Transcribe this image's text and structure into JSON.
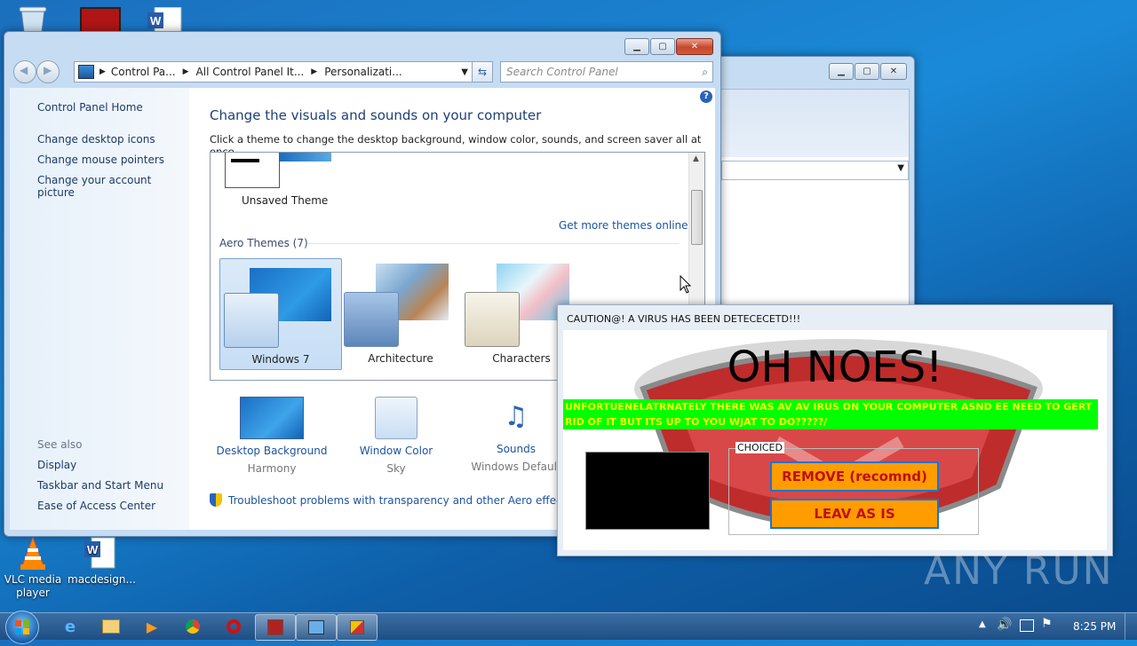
{
  "desktop": {
    "icons": [
      {
        "label": "VLC media player"
      },
      {
        "label": "macdesign..."
      }
    ],
    "watermark": "ANY RUN"
  },
  "control_panel": {
    "breadcrumb": [
      "Control Pa...",
      "All Control Panel It...",
      "Personalizati..."
    ],
    "search_placeholder": "Search Control Panel",
    "sidebar": {
      "home": "Control Panel Home",
      "links": [
        "Change desktop icons",
        "Change mouse pointers",
        "Change your account picture"
      ],
      "see_also_title": "See also",
      "see_also": [
        "Display",
        "Taskbar and Start Menu",
        "Ease of Access Center"
      ]
    },
    "main": {
      "title": "Change the visuals and sounds on your computer",
      "subtitle": "Click a theme to change the desktop background, window color, sounds, and screen saver all at once.",
      "unsaved_theme": "Unsaved Theme",
      "get_more": "Get more themes online",
      "aero_header": "Aero Themes (7)",
      "themes": [
        "Windows 7",
        "Architecture",
        "Characters"
      ],
      "bottom": [
        {
          "title": "Desktop Background",
          "value": "Harmony"
        },
        {
          "title": "Window Color",
          "value": "Sky"
        },
        {
          "title": "Sounds",
          "value": "Windows Default"
        }
      ],
      "troubleshoot": "Troubleshoot problems with transparency and other Aero effects"
    }
  },
  "virus_dialog": {
    "title": "CAUTION@! A VIRUS HAS BEEN DETECECETD!!!",
    "headline": "OH NOES!",
    "message": "UNFORTUENELATRNATELY THERE WAS AV AV IRUS ON YOUR COMPUTER ASND EE NEED TO GERT RID OF IT BUT ITS UP TO YOU WJAT TO DO?????/",
    "group_label": "CHOICED",
    "remove_label": "REMOVE (recomnd)",
    "leave_label": "LEAV AS IS"
  },
  "taskbar": {
    "clock": "8:25 PM"
  },
  "colors": {
    "accent_link": "#1d53a3",
    "message_bg": "#00ff00",
    "message_fg": "#ffff00",
    "button_bg": "#ff9d00",
    "button_fg": "#c01010"
  }
}
